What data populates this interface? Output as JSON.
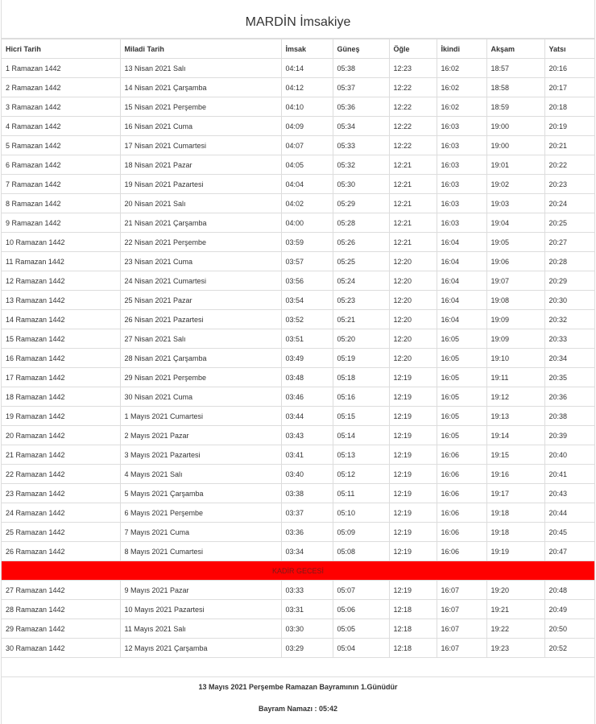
{
  "title": "MARDİN İmsakiye",
  "headers": [
    "Hicri Tarih",
    "Miladi Tarih",
    "İmsak",
    "Güneş",
    "Öğle",
    "İkindi",
    "Akşam",
    "Yatsı"
  ],
  "rows_before": [
    [
      "1 Ramazan 1442",
      "13 Nisan 2021 Salı",
      "04:14",
      "05:38",
      "12:23",
      "16:02",
      "18:57",
      "20:16"
    ],
    [
      "2 Ramazan 1442",
      "14 Nisan 2021 Çarşamba",
      "04:12",
      "05:37",
      "12:22",
      "16:02",
      "18:58",
      "20:17"
    ],
    [
      "3 Ramazan 1442",
      "15 Nisan 2021 Perşembe",
      "04:10",
      "05:36",
      "12:22",
      "16:02",
      "18:59",
      "20:18"
    ],
    [
      "4 Ramazan 1442",
      "16 Nisan 2021 Cuma",
      "04:09",
      "05:34",
      "12:22",
      "16:03",
      "19:00",
      "20:19"
    ],
    [
      "5 Ramazan 1442",
      "17 Nisan 2021 Cumartesi",
      "04:07",
      "05:33",
      "12:22",
      "16:03",
      "19:00",
      "20:21"
    ],
    [
      "6 Ramazan 1442",
      "18 Nisan 2021 Pazar",
      "04:05",
      "05:32",
      "12:21",
      "16:03",
      "19:01",
      "20:22"
    ],
    [
      "7 Ramazan 1442",
      "19 Nisan 2021 Pazartesi",
      "04:04",
      "05:30",
      "12:21",
      "16:03",
      "19:02",
      "20:23"
    ],
    [
      "8 Ramazan 1442",
      "20 Nisan 2021 Salı",
      "04:02",
      "05:29",
      "12:21",
      "16:03",
      "19:03",
      "20:24"
    ],
    [
      "9 Ramazan 1442",
      "21 Nisan 2021 Çarşamba",
      "04:00",
      "05:28",
      "12:21",
      "16:03",
      "19:04",
      "20:25"
    ],
    [
      "10 Ramazan 1442",
      "22 Nisan 2021 Perşembe",
      "03:59",
      "05:26",
      "12:21",
      "16:04",
      "19:05",
      "20:27"
    ],
    [
      "11 Ramazan 1442",
      "23 Nisan 2021 Cuma",
      "03:57",
      "05:25",
      "12:20",
      "16:04",
      "19:06",
      "20:28"
    ],
    [
      "12 Ramazan 1442",
      "24 Nisan 2021 Cumartesi",
      "03:56",
      "05:24",
      "12:20",
      "16:04",
      "19:07",
      "20:29"
    ],
    [
      "13 Ramazan 1442",
      "25 Nisan 2021 Pazar",
      "03:54",
      "05:23",
      "12:20",
      "16:04",
      "19:08",
      "20:30"
    ],
    [
      "14 Ramazan 1442",
      "26 Nisan 2021 Pazartesi",
      "03:52",
      "05:21",
      "12:20",
      "16:04",
      "19:09",
      "20:32"
    ],
    [
      "15 Ramazan 1442",
      "27 Nisan 2021 Salı",
      "03:51",
      "05:20",
      "12:20",
      "16:05",
      "19:09",
      "20:33"
    ],
    [
      "16 Ramazan 1442",
      "28 Nisan 2021 Çarşamba",
      "03:49",
      "05:19",
      "12:20",
      "16:05",
      "19:10",
      "20:34"
    ],
    [
      "17 Ramazan 1442",
      "29 Nisan 2021 Perşembe",
      "03:48",
      "05:18",
      "12:19",
      "16:05",
      "19:11",
      "20:35"
    ],
    [
      "18 Ramazan 1442",
      "30 Nisan 2021 Cuma",
      "03:46",
      "05:16",
      "12:19",
      "16:05",
      "19:12",
      "20:36"
    ],
    [
      "19 Ramazan 1442",
      "1 Mayıs 2021 Cumartesi",
      "03:44",
      "05:15",
      "12:19",
      "16:05",
      "19:13",
      "20:38"
    ],
    [
      "20 Ramazan 1442",
      "2 Mayıs 2021 Pazar",
      "03:43",
      "05:14",
      "12:19",
      "16:05",
      "19:14",
      "20:39"
    ],
    [
      "21 Ramazan 1442",
      "3 Mayıs 2021 Pazartesi",
      "03:41",
      "05:13",
      "12:19",
      "16:06",
      "19:15",
      "20:40"
    ],
    [
      "22 Ramazan 1442",
      "4 Mayıs 2021 Salı",
      "03:40",
      "05:12",
      "12:19",
      "16:06",
      "19:16",
      "20:41"
    ],
    [
      "23 Ramazan 1442",
      "5 Mayıs 2021 Çarşamba",
      "03:38",
      "05:11",
      "12:19",
      "16:06",
      "19:17",
      "20:43"
    ],
    [
      "24 Ramazan 1442",
      "6 Mayıs 2021 Perşembe",
      "03:37",
      "05:10",
      "12:19",
      "16:06",
      "19:18",
      "20:44"
    ],
    [
      "25 Ramazan 1442",
      "7 Mayıs 2021 Cuma",
      "03:36",
      "05:09",
      "12:19",
      "16:06",
      "19:18",
      "20:45"
    ],
    [
      "26 Ramazan 1442",
      "8 Mayıs 2021 Cumartesi",
      "03:34",
      "05:08",
      "12:19",
      "16:06",
      "19:19",
      "20:47"
    ]
  ],
  "kadir_label": "KADİR GECESİ",
  "kadir_color": "#ff0000",
  "rows_after": [
    [
      "27 Ramazan 1442",
      "9 Mayıs 2021 Pazar",
      "03:33",
      "05:07",
      "12:19",
      "16:07",
      "19:20",
      "20:48"
    ],
    [
      "28 Ramazan 1442",
      "10 Mayıs 2021 Pazartesi",
      "03:31",
      "05:06",
      "12:18",
      "16:07",
      "19:21",
      "20:49"
    ],
    [
      "29 Ramazan 1442",
      "11 Mayıs 2021 Salı",
      "03:30",
      "05:05",
      "12:18",
      "16:07",
      "19:22",
      "20:50"
    ],
    [
      "30 Ramazan 1442",
      "12 Mayıs 2021 Çarşamba",
      "03:29",
      "05:04",
      "12:18",
      "16:07",
      "19:23",
      "20:52"
    ]
  ],
  "footer": {
    "bayram_text": "13 Mayıs 2021 Perşembe Ramazan Bayramının 1.Günüdür",
    "namaz_text": "Bayram Namazı : 05:42"
  }
}
